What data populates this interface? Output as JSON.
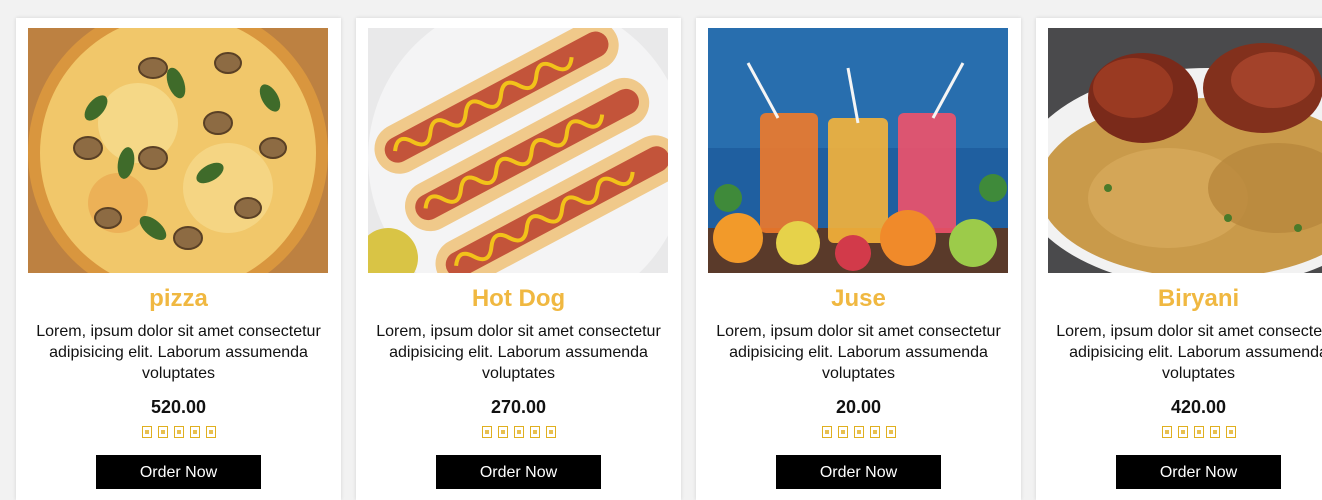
{
  "products": [
    {
      "name": "pizza",
      "description": "Lorem, ipsum dolor sit amet consectetur adipisicing elit. Laborum assumenda voluptates",
      "price": "520.00",
      "rating": 5,
      "order_label": "Order Now"
    },
    {
      "name": "Hot Dog",
      "description": "Lorem, ipsum dolor sit amet consectetur adipisicing elit. Laborum assumenda voluptates",
      "price": "270.00",
      "rating": 5,
      "order_label": "Order Now"
    },
    {
      "name": "Juse",
      "description": "Lorem, ipsum dolor sit amet consectetur adipisicing elit. Laborum assumenda voluptates",
      "price": "20.00",
      "rating": 5,
      "order_label": "Order Now"
    },
    {
      "name": "Biryani",
      "description": "Lorem, ipsum dolor sit amet consectetur adipisicing elit. Laborum assumenda voluptates",
      "price": "420.00",
      "rating": 5,
      "order_label": "Order Now"
    }
  ],
  "colors": {
    "title": "#f0b841",
    "button_bg": "#000000",
    "button_text": "#ffffff",
    "card_bg": "#ffffff"
  },
  "icons": {
    "rating": "star-icon"
  }
}
